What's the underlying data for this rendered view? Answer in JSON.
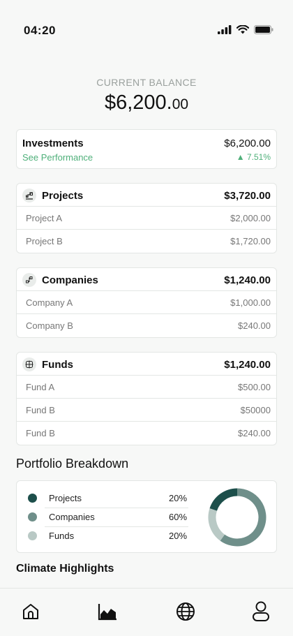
{
  "status_bar": {
    "time": "04:20"
  },
  "balance": {
    "label": "CURRENT BALANCE",
    "main": "$6,200.",
    "cents": "00"
  },
  "investments": {
    "title": "Investments",
    "link": "See Performance",
    "value": "$6,200.00",
    "change": "▲ 7.51%",
    "change_color": "#4fb07a"
  },
  "groups": [
    {
      "title": "Projects",
      "total": "$3,720.00",
      "icon": "projects-icon",
      "items": [
        {
          "name": "Project A",
          "value": "$2,000.00"
        },
        {
          "name": "Project B",
          "value": "$1,720.00"
        }
      ]
    },
    {
      "title": "Companies",
      "total": "$1,240.00",
      "icon": "companies-icon",
      "items": [
        {
          "name": "Company A",
          "value": "$1,000.00"
        },
        {
          "name": "Company B",
          "value": "$240.00"
        }
      ]
    },
    {
      "title": "Funds",
      "total": "$1,240.00",
      "icon": "funds-icon",
      "items": [
        {
          "name": "Fund A",
          "value": "$500.00"
        },
        {
          "name": "Fund B",
          "value": "$50000"
        },
        {
          "name": "Fund B",
          "value": "$240.00"
        }
      ]
    }
  ],
  "breakdown": {
    "title": "Portfolio Breakdown",
    "items": [
      {
        "name": "Projects",
        "pct": "20%",
        "color": "#1d4f4b"
      },
      {
        "name": "Companies",
        "pct": "60%",
        "color": "#6f8f8a"
      },
      {
        "name": "Funds",
        "pct": "20%",
        "color": "#b9c9c5"
      }
    ]
  },
  "chart_data": {
    "type": "pie",
    "categories": [
      "Projects",
      "Companies",
      "Funds"
    ],
    "values": [
      20,
      60,
      20
    ],
    "title": "",
    "colors": [
      "#1d4f4b",
      "#6f8f8a",
      "#b9c9c5"
    ],
    "donut": true
  },
  "climate": {
    "title": "Climate Highlights"
  },
  "tabs": [
    {
      "icon": "home-icon"
    },
    {
      "icon": "chart-icon"
    },
    {
      "icon": "globe-icon"
    },
    {
      "icon": "profile-icon"
    }
  ]
}
